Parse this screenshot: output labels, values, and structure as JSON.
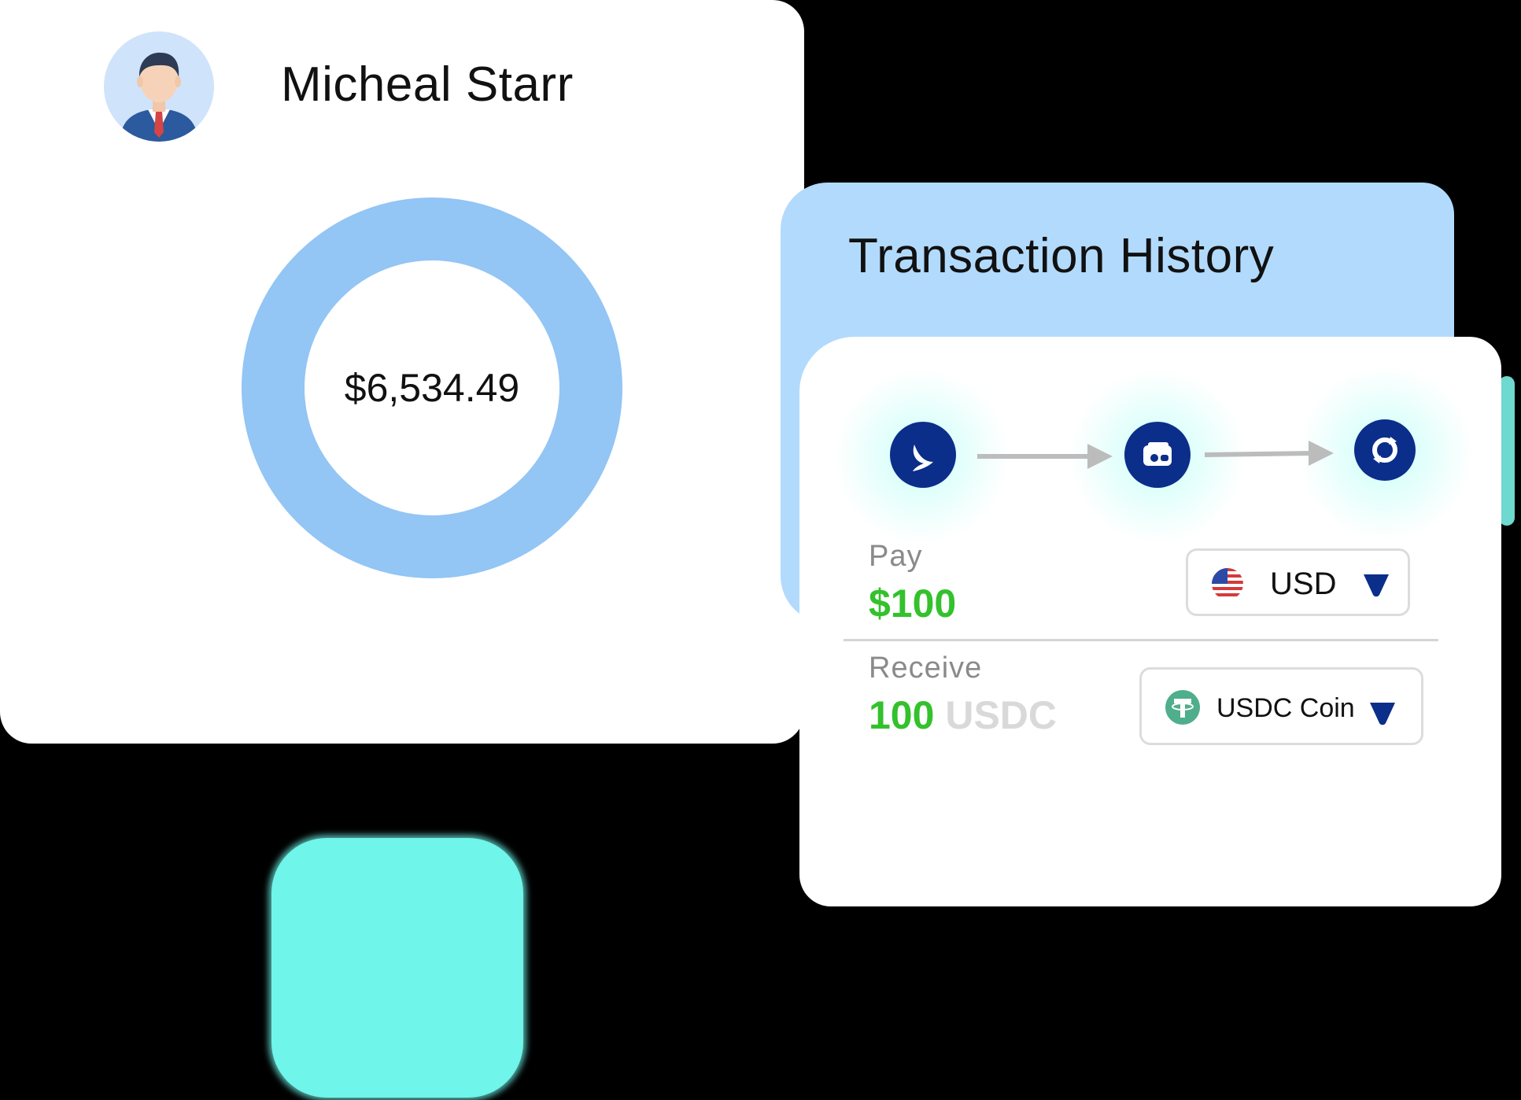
{
  "profile": {
    "name": "Micheal Starr",
    "avatar_icon": "businessman-avatar-icon",
    "balance": "$6,534.49",
    "ring_color": "#93c5f5"
  },
  "transactions": {
    "title": "Transaction History",
    "steps": [
      {
        "icon": "pay-bird-icon"
      },
      {
        "icon": "wallet-icon"
      },
      {
        "icon": "exchange-icon"
      }
    ],
    "pay": {
      "label": "Pay",
      "amount": "$100",
      "currency": "USD",
      "currency_icon": "us-flag-icon"
    },
    "receive": {
      "label": "Receive",
      "amount": "100",
      "unit": "USDC",
      "currency": "USDC Coin",
      "currency_icon": "tether-coin-icon"
    }
  },
  "colors": {
    "accent_navy": "#0b2e8a",
    "amount_green": "#33c12c",
    "panel_blue": "#b2dafc",
    "teal": "#6ff5ea"
  }
}
